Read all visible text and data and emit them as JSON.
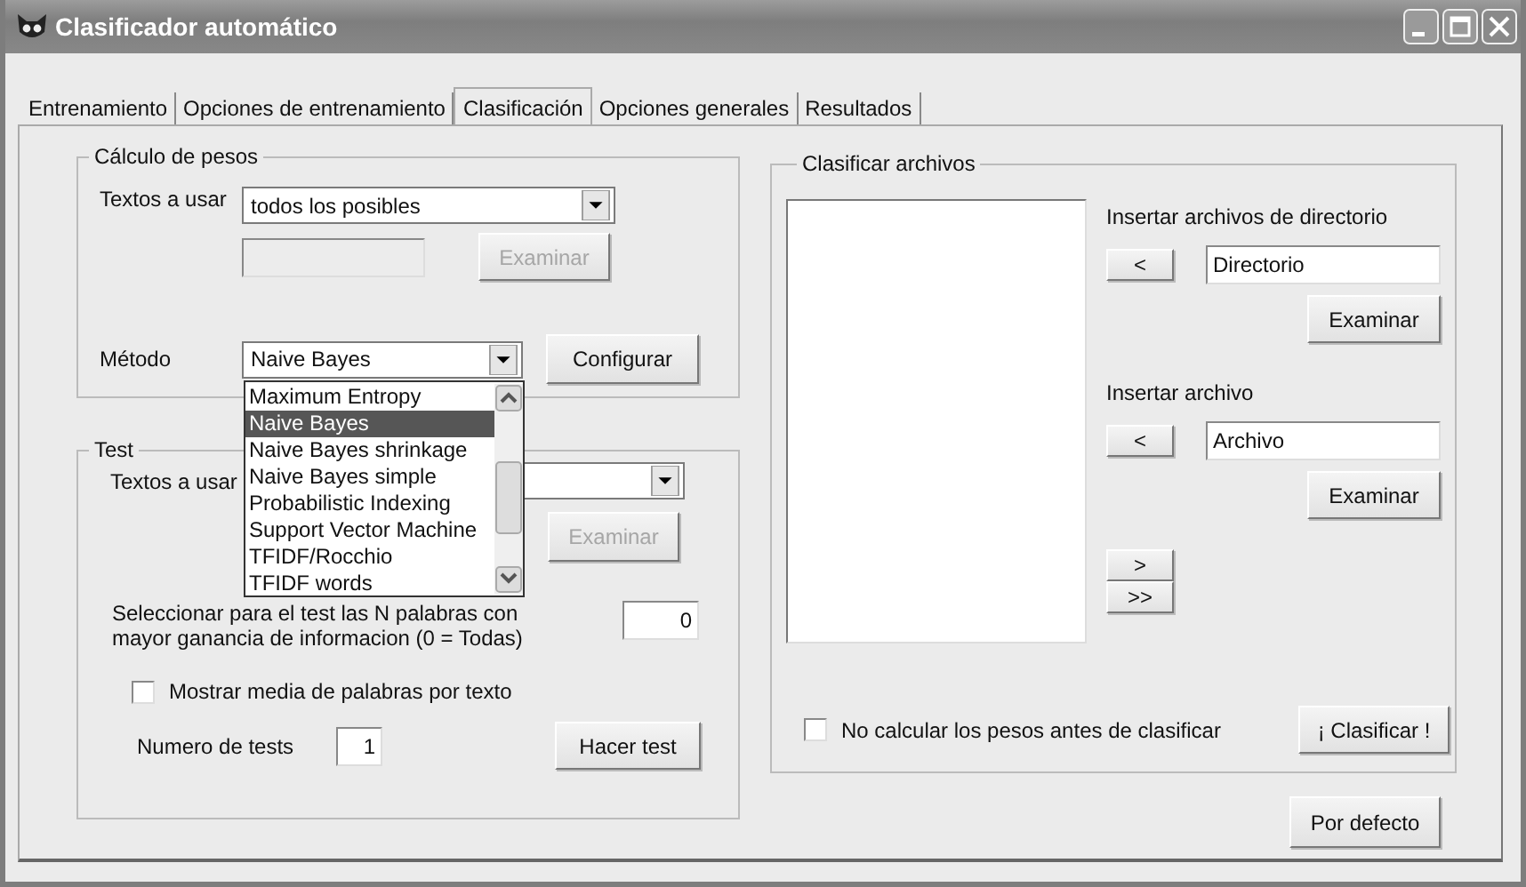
{
  "window": {
    "title": "Clasificador automático"
  },
  "tabs": [
    {
      "label": "Entrenamiento",
      "selected": false
    },
    {
      "label": "Opciones de entrenamiento",
      "selected": false
    },
    {
      "label": "Clasificación",
      "selected": true
    },
    {
      "label": "Opciones generales",
      "selected": false
    },
    {
      "label": "Resultados",
      "selected": false
    }
  ],
  "weights": {
    "title": "Cálculo de pesos",
    "texts_label": "Textos a usar",
    "texts_value": "todos los posibles",
    "browse_button": {
      "label": "Examinar",
      "disabled": true
    },
    "method_label": "Método",
    "method_value": "Naive Bayes",
    "configure_button": "Configurar",
    "method_options": [
      {
        "label": "Maximum Entropy",
        "selected": false
      },
      {
        "label": "Naive Bayes",
        "selected": true
      },
      {
        "label": "Naive Bayes shrinkage",
        "selected": false
      },
      {
        "label": "Naive Bayes simple",
        "selected": false
      },
      {
        "label": "Probabilistic Indexing",
        "selected": false
      },
      {
        "label": "Support Vector Machine",
        "selected": false
      },
      {
        "label": "TFIDF/Rocchio",
        "selected": false
      },
      {
        "label": "TFIDF words",
        "selected": false
      }
    ]
  },
  "test": {
    "title": "Test",
    "texts_label": "Textos a usar",
    "browse_button": {
      "label": "Examinar",
      "disabled": true
    },
    "top_words_label": "Seleccionar para el test las N palabras con mayor ganancia de informacion (0 = Todas)",
    "top_words_value": "0",
    "show_mean_checkbox": {
      "label": "Mostrar media de palabras por texto",
      "checked": false
    },
    "num_tests_label": "Numero de tests",
    "num_tests_value": "1",
    "run_button": "Hacer test"
  },
  "classify": {
    "title": "Clasificar archivos",
    "dir_label": "Insertar archivos de directorio",
    "dir_add_button": "<",
    "dir_value": "Directorio",
    "dir_browse_button": "Examinar",
    "file_label": "Insertar archivo",
    "file_add_button": "<",
    "file_value": "Archivo",
    "file_browse_button": "Examinar",
    "move_buttons": [
      ">",
      ">>"
    ],
    "skip_weights_checkbox": {
      "label": "No calcular los pesos antes de clasificar",
      "checked": false
    },
    "classify_button": "¡ Clasificar !"
  },
  "default_button": "Por defecto"
}
